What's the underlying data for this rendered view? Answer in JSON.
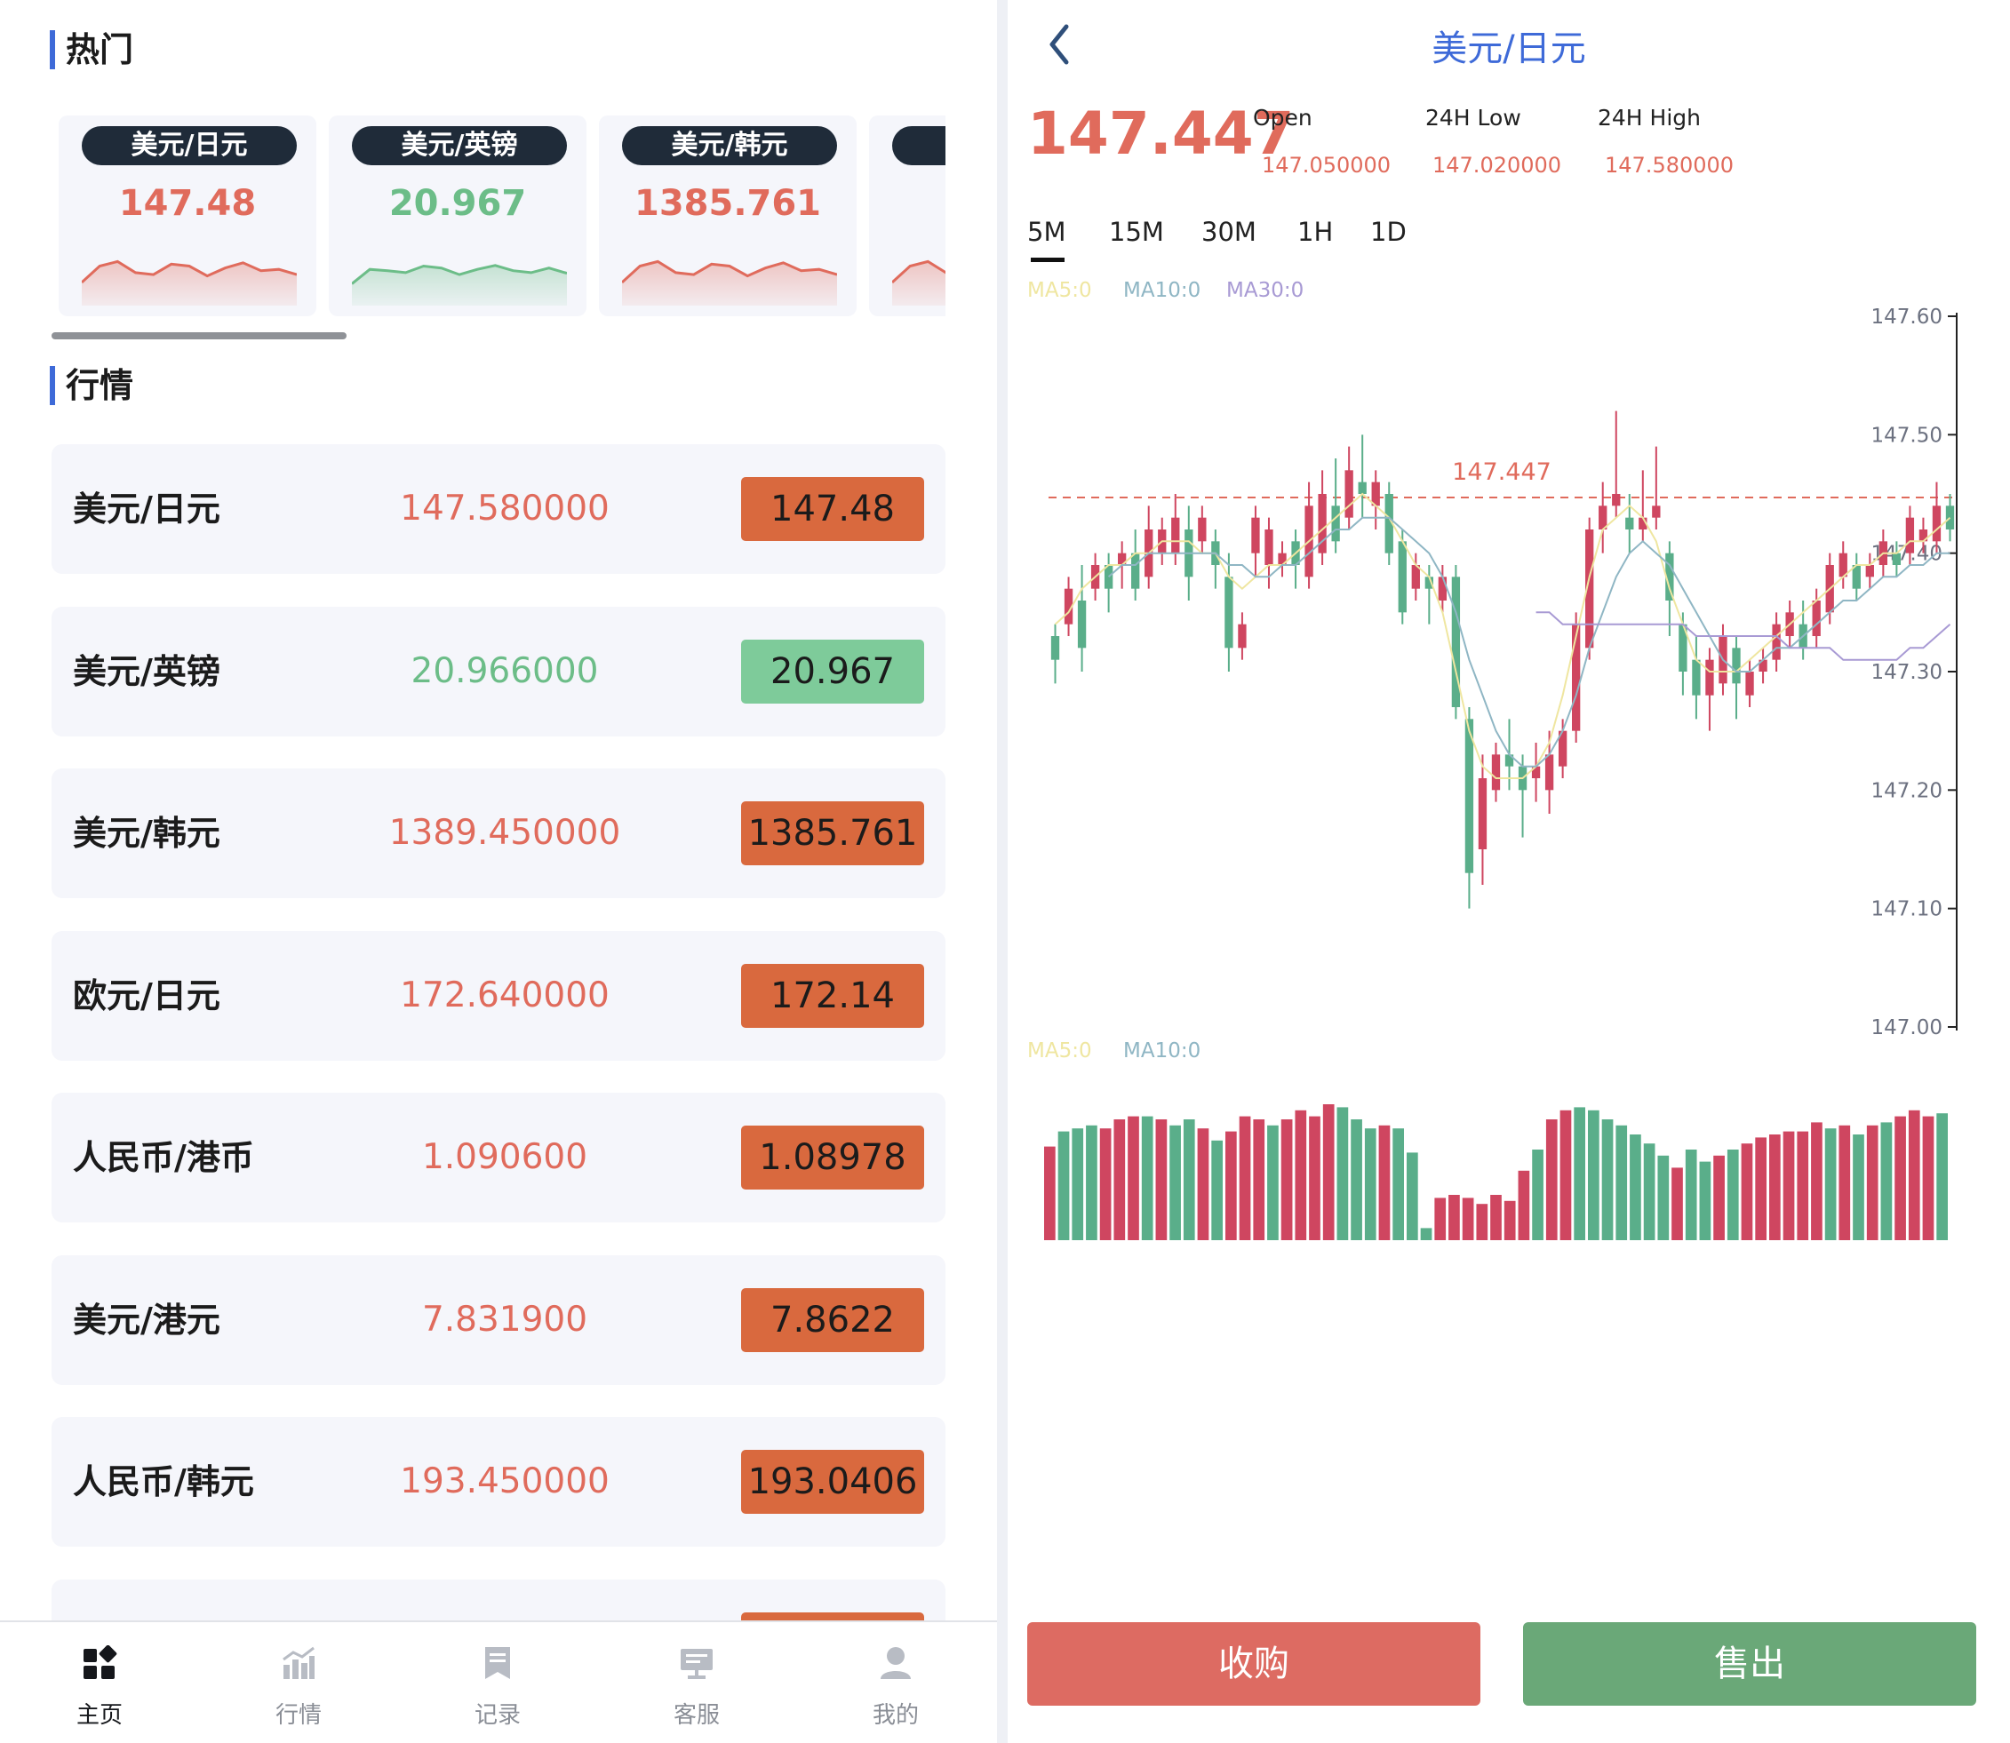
{
  "left": {
    "hot_title": "热门",
    "hot_cards": [
      {
        "pair": "美元/日元",
        "price": "147.48",
        "trend": "up",
        "spark": [
          0.3,
          0.55,
          0.62,
          0.45,
          0.42,
          0.58,
          0.55,
          0.4,
          0.52,
          0.6,
          0.48,
          0.5,
          0.42
        ]
      },
      {
        "pair": "美元/英镑",
        "price": "20.967",
        "trend": "down",
        "spark": [
          0.28,
          0.5,
          0.48,
          0.45,
          0.55,
          0.52,
          0.42,
          0.5,
          0.56,
          0.48,
          0.45,
          0.52,
          0.44
        ]
      },
      {
        "pair": "美元/韩元",
        "price": "1385.761",
        "trend": "up",
        "spark": [
          0.3,
          0.55,
          0.62,
          0.45,
          0.42,
          0.58,
          0.55,
          0.4,
          0.52,
          0.6,
          0.48,
          0.5,
          0.42
        ]
      },
      {
        "pair": "",
        "price": "",
        "trend": "up",
        "spark": [
          0.3,
          0.55,
          0.62,
          0.45,
          0.42,
          0.58,
          0.55,
          0.4,
          0.52,
          0.6,
          0.48,
          0.5,
          0.42
        ]
      }
    ],
    "market_title": "行情",
    "rows": [
      {
        "name": "美元/日元",
        "price": "147.580000",
        "change": "147.48",
        "direction": "up"
      },
      {
        "name": "美元/英镑",
        "price": "20.966000",
        "change": "20.967",
        "direction": "down"
      },
      {
        "name": "美元/韩元",
        "price": "1389.450000",
        "change": "1385.761",
        "direction": "up"
      },
      {
        "name": "欧元/日元",
        "price": "172.640000",
        "change": "172.14",
        "direction": "up"
      },
      {
        "name": "人民币/港币",
        "price": "1.090600",
        "change": "1.08978",
        "direction": "up"
      },
      {
        "name": "美元/港元",
        "price": "7.831900",
        "change": "7.8622",
        "direction": "up"
      },
      {
        "name": "人民币/韩元",
        "price": "193.450000",
        "change": "193.0406",
        "direction": "up"
      },
      {
        "name": "",
        "price": "",
        "change": "",
        "direction": "up"
      }
    ],
    "nav": [
      {
        "label": "主页",
        "icon": "home-grid-icon",
        "active": true
      },
      {
        "label": "行情",
        "icon": "market-chart-icon",
        "active": false
      },
      {
        "label": "记录",
        "icon": "record-document-icon",
        "active": false
      },
      {
        "label": "客服",
        "icon": "customer-service-icon",
        "active": false
      },
      {
        "label": "我的",
        "icon": "user-profile-icon",
        "active": false
      }
    ]
  },
  "right": {
    "title": "美元/日元",
    "price": "147.447",
    "stats": [
      {
        "label": "Open",
        "value": "147.050000"
      },
      {
        "label": "24H Low",
        "value": "147.020000"
      },
      {
        "label": "24H High",
        "value": "147.580000"
      }
    ],
    "timeframes": [
      "5M",
      "15M",
      "30M",
      "1H",
      "1D"
    ],
    "active_timeframe": "5M",
    "ma_main": [
      "MA5:0",
      "MA10:0",
      "MA30:0"
    ],
    "ma_volume": [
      "MA5:0",
      "MA10:0"
    ],
    "buy_label": "收购",
    "sell_label": "售出"
  },
  "colors": {
    "up": "#e06b5c",
    "down": "#6cbd88",
    "up_badge": "#d9693e",
    "down_badge": "#7ecb9a",
    "candle_up": "#cf4660",
    "candle_down": "#5aae8a",
    "buy_button": "#dd6b62",
    "sell_button": "#6aa878",
    "accent": "#3e6ad8",
    "ma5": "#efe6a0",
    "ma10": "#8fb6c4",
    "ma30": "#a89ad4"
  },
  "chart_data": {
    "type": "candlestick",
    "title": "",
    "ylim": [
      147.0,
      147.6
    ],
    "y_ticks": [
      "147.60",
      "147.50",
      "147.40",
      "147.30",
      "147.20",
      "147.10",
      "147.00"
    ],
    "current_price": 147.447,
    "current_price_label": "147.447",
    "candles": [
      {
        "o": 147.33,
        "c": 147.31,
        "h": 147.34,
        "l": 147.29
      },
      {
        "o": 147.34,
        "c": 147.37,
        "h": 147.38,
        "l": 147.33
      },
      {
        "o": 147.36,
        "c": 147.32,
        "h": 147.39,
        "l": 147.3
      },
      {
        "o": 147.37,
        "c": 147.39,
        "h": 147.4,
        "l": 147.36
      },
      {
        "o": 147.39,
        "c": 147.37,
        "h": 147.4,
        "l": 147.35
      },
      {
        "o": 147.39,
        "c": 147.4,
        "h": 147.41,
        "l": 147.37
      },
      {
        "o": 147.4,
        "c": 147.37,
        "h": 147.42,
        "l": 147.36
      },
      {
        "o": 147.38,
        "c": 147.42,
        "h": 147.44,
        "l": 147.37
      },
      {
        "o": 147.4,
        "c": 147.42,
        "h": 147.43,
        "l": 147.39
      },
      {
        "o": 147.4,
        "c": 147.43,
        "h": 147.45,
        "l": 147.39
      },
      {
        "o": 147.42,
        "c": 147.38,
        "h": 147.44,
        "l": 147.36
      },
      {
        "o": 147.41,
        "c": 147.43,
        "h": 147.44,
        "l": 147.4
      },
      {
        "o": 147.41,
        "c": 147.39,
        "h": 147.42,
        "l": 147.37
      },
      {
        "o": 147.38,
        "c": 147.32,
        "h": 147.4,
        "l": 147.3
      },
      {
        "o": 147.32,
        "c": 147.34,
        "h": 147.35,
        "l": 147.31
      },
      {
        "o": 147.4,
        "c": 147.43,
        "h": 147.44,
        "l": 147.38
      },
      {
        "o": 147.39,
        "c": 147.42,
        "h": 147.43,
        "l": 147.37
      },
      {
        "o": 147.39,
        "c": 147.4,
        "h": 147.41,
        "l": 147.38
      },
      {
        "o": 147.41,
        "c": 147.39,
        "h": 147.42,
        "l": 147.37
      },
      {
        "o": 147.38,
        "c": 147.44,
        "h": 147.46,
        "l": 147.37
      },
      {
        "o": 147.4,
        "c": 147.45,
        "h": 147.47,
        "l": 147.39
      },
      {
        "o": 147.44,
        "c": 147.41,
        "h": 147.48,
        "l": 147.4
      },
      {
        "o": 147.43,
        "c": 147.47,
        "h": 147.49,
        "l": 147.42
      },
      {
        "o": 147.46,
        "c": 147.45,
        "h": 147.5,
        "l": 147.43
      },
      {
        "o": 147.44,
        "c": 147.46,
        "h": 147.47,
        "l": 147.42
      },
      {
        "o": 147.45,
        "c": 147.4,
        "h": 147.46,
        "l": 147.39
      },
      {
        "o": 147.41,
        "c": 147.35,
        "h": 147.42,
        "l": 147.34
      },
      {
        "o": 147.37,
        "c": 147.39,
        "h": 147.4,
        "l": 147.36
      },
      {
        "o": 147.38,
        "c": 147.37,
        "h": 147.39,
        "l": 147.34
      },
      {
        "o": 147.36,
        "c": 147.38,
        "h": 147.39,
        "l": 147.35
      },
      {
        "o": 147.38,
        "c": 147.27,
        "h": 147.39,
        "l": 147.26
      },
      {
        "o": 147.26,
        "c": 147.13,
        "h": 147.27,
        "l": 147.1
      },
      {
        "o": 147.15,
        "c": 147.21,
        "h": 147.23,
        "l": 147.12
      },
      {
        "o": 147.2,
        "c": 147.23,
        "h": 147.24,
        "l": 147.19
      },
      {
        "o": 147.23,
        "c": 147.22,
        "h": 147.26,
        "l": 147.2
      },
      {
        "o": 147.22,
        "c": 147.2,
        "h": 147.23,
        "l": 147.16
      },
      {
        "o": 147.21,
        "c": 147.22,
        "h": 147.24,
        "l": 147.19
      },
      {
        "o": 147.2,
        "c": 147.23,
        "h": 147.25,
        "l": 147.18
      },
      {
        "o": 147.22,
        "c": 147.25,
        "h": 147.26,
        "l": 147.21
      },
      {
        "o": 147.25,
        "c": 147.34,
        "h": 147.35,
        "l": 147.24
      },
      {
        "o": 147.32,
        "c": 147.42,
        "h": 147.43,
        "l": 147.31
      },
      {
        "o": 147.42,
        "c": 147.44,
        "h": 147.46,
        "l": 147.4
      },
      {
        "o": 147.44,
        "c": 147.45,
        "h": 147.52,
        "l": 147.43
      },
      {
        "o": 147.43,
        "c": 147.42,
        "h": 147.45,
        "l": 147.4
      },
      {
        "o": 147.42,
        "c": 147.43,
        "h": 147.47,
        "l": 147.41
      },
      {
        "o": 147.43,
        "c": 147.44,
        "h": 147.49,
        "l": 147.42
      },
      {
        "o": 147.4,
        "c": 147.36,
        "h": 147.41,
        "l": 147.33
      },
      {
        "o": 147.34,
        "c": 147.3,
        "h": 147.35,
        "l": 147.28
      },
      {
        "o": 147.31,
        "c": 147.28,
        "h": 147.33,
        "l": 147.26
      },
      {
        "o": 147.28,
        "c": 147.31,
        "h": 147.32,
        "l": 147.25
      },
      {
        "o": 147.29,
        "c": 147.33,
        "h": 147.34,
        "l": 147.28
      },
      {
        "o": 147.32,
        "c": 147.29,
        "h": 147.33,
        "l": 147.26
      },
      {
        "o": 147.28,
        "c": 147.3,
        "h": 147.31,
        "l": 147.27
      },
      {
        "o": 147.3,
        "c": 147.31,
        "h": 147.32,
        "l": 147.29
      },
      {
        "o": 147.31,
        "c": 147.34,
        "h": 147.35,
        "l": 147.3
      },
      {
        "o": 147.33,
        "c": 147.35,
        "h": 147.36,
        "l": 147.32
      },
      {
        "o": 147.34,
        "c": 147.32,
        "h": 147.36,
        "l": 147.31
      },
      {
        "o": 147.33,
        "c": 147.36,
        "h": 147.37,
        "l": 147.32
      },
      {
        "o": 147.35,
        "c": 147.39,
        "h": 147.4,
        "l": 147.34
      },
      {
        "o": 147.38,
        "c": 147.4,
        "h": 147.41,
        "l": 147.37
      },
      {
        "o": 147.39,
        "c": 147.37,
        "h": 147.4,
        "l": 147.36
      },
      {
        "o": 147.38,
        "c": 147.39,
        "h": 147.4,
        "l": 147.37
      },
      {
        "o": 147.39,
        "c": 147.41,
        "h": 147.42,
        "l": 147.38
      },
      {
        "o": 147.4,
        "c": 147.39,
        "h": 147.41,
        "l": 147.38
      },
      {
        "o": 147.4,
        "c": 147.43,
        "h": 147.44,
        "l": 147.39
      },
      {
        "o": 147.41,
        "c": 147.42,
        "h": 147.43,
        "l": 147.4
      },
      {
        "o": 147.41,
        "c": 147.44,
        "h": 147.46,
        "l": 147.4
      },
      {
        "o": 147.44,
        "c": 147.42,
        "h": 147.45,
        "l": 147.41
      }
    ],
    "ma5": [
      147.34,
      147.35,
      147.37,
      147.38,
      147.39,
      147.39,
      147.4,
      147.4,
      147.41,
      147.41,
      147.41,
      147.4,
      147.4,
      147.38,
      147.37,
      147.38,
      147.39,
      147.39,
      147.4,
      147.41,
      147.42,
      147.43,
      147.44,
      147.45,
      147.44,
      147.43,
      147.41,
      147.39,
      147.38,
      147.35,
      147.3,
      147.25,
      147.22,
      147.21,
      147.21,
      147.21,
      147.22,
      147.24,
      147.28,
      147.33,
      147.38,
      147.42,
      147.43,
      147.44,
      147.43,
      147.41,
      147.37,
      147.34,
      147.31,
      147.3,
      147.3,
      147.3,
      147.31,
      147.32,
      147.33,
      147.34,
      147.35,
      147.36,
      147.37,
      147.38,
      147.39,
      147.39,
      147.4,
      147.4,
      147.41,
      147.41,
      147.42,
      147.43
    ],
    "ma10": [
      null,
      null,
      null,
      null,
      147.38,
      147.39,
      147.39,
      147.4,
      147.4,
      147.4,
      147.4,
      147.4,
      147.4,
      147.39,
      147.39,
      147.38,
      147.38,
      147.39,
      147.39,
      147.4,
      147.41,
      147.42,
      147.42,
      147.43,
      147.43,
      147.43,
      147.42,
      147.41,
      147.4,
      147.38,
      147.35,
      147.31,
      147.28,
      147.25,
      147.23,
      147.22,
      147.22,
      147.23,
      147.25,
      147.28,
      147.32,
      147.35,
      147.38,
      147.4,
      147.41,
      147.4,
      147.39,
      147.37,
      147.35,
      147.33,
      147.31,
      147.3,
      147.3,
      147.31,
      147.32,
      147.32,
      147.33,
      147.34,
      147.35,
      147.36,
      147.36,
      147.37,
      147.38,
      147.38,
      147.39,
      147.39,
      147.4,
      147.4
    ],
    "ma30": [
      null,
      null,
      null,
      null,
      null,
      null,
      null,
      null,
      null,
      null,
      null,
      null,
      null,
      null,
      null,
      null,
      null,
      null,
      null,
      null,
      null,
      null,
      null,
      null,
      null,
      null,
      null,
      null,
      null,
      null,
      null,
      null,
      null,
      null,
      null,
      null,
      147.35,
      147.35,
      147.34,
      147.34,
      147.34,
      147.34,
      147.34,
      147.34,
      147.34,
      147.34,
      147.34,
      147.34,
      147.33,
      147.33,
      147.33,
      147.33,
      147.33,
      147.33,
      147.33,
      147.32,
      147.32,
      147.32,
      147.32,
      147.31,
      147.31,
      147.31,
      147.31,
      147.31,
      147.32,
      147.32,
      147.33,
      147.34
    ],
    "volumes": [
      0.62,
      0.72,
      0.74,
      0.76,
      0.74,
      0.8,
      0.82,
      0.82,
      0.8,
      0.76,
      0.8,
      0.74,
      0.66,
      0.72,
      0.82,
      0.8,
      0.76,
      0.8,
      0.86,
      0.82,
      0.9,
      0.88,
      0.8,
      0.74,
      0.76,
      0.74,
      0.58,
      0.08,
      0.28,
      0.3,
      0.28,
      0.24,
      0.3,
      0.26,
      0.46,
      0.6,
      0.8,
      0.86,
      0.88,
      0.86,
      0.8,
      0.76,
      0.7,
      0.64,
      0.56,
      0.48,
      0.6,
      0.52,
      0.56,
      0.6,
      0.64,
      0.68,
      0.7,
      0.72,
      0.72,
      0.78,
      0.74,
      0.76,
      0.7,
      0.76,
      0.78,
      0.82,
      0.86,
      0.82,
      0.84
    ],
    "volume_direction": [
      "up",
      "down",
      "down",
      "down",
      "up",
      "up",
      "up",
      "down",
      "up",
      "down",
      "down",
      "up",
      "down",
      "up",
      "up",
      "up",
      "down",
      "up",
      "up",
      "up",
      "up",
      "down",
      "down",
      "down",
      "up",
      "down",
      "down",
      "down",
      "up",
      "up",
      "up",
      "up",
      "up",
      "up",
      "up",
      "down",
      "up",
      "up",
      "down",
      "down",
      "down",
      "down",
      "down",
      "down",
      "down",
      "up",
      "down",
      "down",
      "up",
      "down",
      "up",
      "up",
      "up",
      "up",
      "up",
      "up",
      "down",
      "up",
      "down",
      "up",
      "down",
      "up",
      "up",
      "up",
      "down"
    ]
  }
}
